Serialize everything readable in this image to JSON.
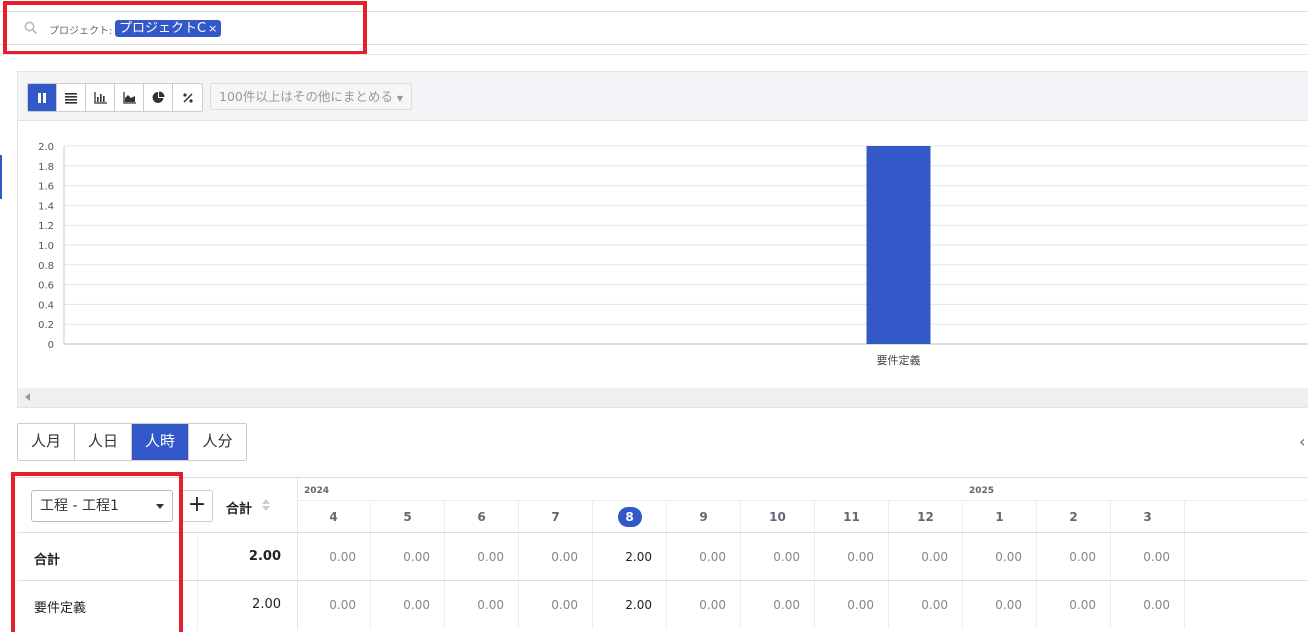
{
  "search": {
    "field_label": "プロジェクト:",
    "chip": "プロジェクトC",
    "chip_remove": "×"
  },
  "toolbar": {
    "icons": [
      "pause-icon",
      "list-icon",
      "bar-chart-icon",
      "area-chart-icon",
      "pie-chart-icon",
      "percent-icon"
    ],
    "group_select": "100件以上はその他にまとめる"
  },
  "chart_data": {
    "type": "bar",
    "categories": [
      "要件定義"
    ],
    "values": [
      2.0
    ],
    "ylim": [
      0,
      2.0
    ],
    "yticks": [
      "0",
      "0.2",
      "0.4",
      "0.6",
      "0.8",
      "1.0",
      "1.2",
      "1.4",
      "1.6",
      "1.8",
      "2.0"
    ],
    "grid": true,
    "colors": {
      "bar": "#3358c8"
    }
  },
  "units": [
    "人月",
    "人日",
    "人時",
    "人分"
  ],
  "active_unit": "人時",
  "table": {
    "dimension_select": "工程 - 工程1",
    "add_label": "+",
    "total_header": "合計",
    "years": [
      "2024",
      "2025"
    ],
    "months": [
      "4",
      "5",
      "6",
      "7",
      "8",
      "9",
      "10",
      "11",
      "12",
      "1",
      "2",
      "3"
    ],
    "current_month": "8",
    "rows": [
      {
        "label": "合計",
        "total": "2.00",
        "values": [
          "0.00",
          "0.00",
          "0.00",
          "0.00",
          "2.00",
          "0.00",
          "0.00",
          "0.00",
          "0.00",
          "0.00",
          "0.00",
          "0.00"
        ]
      },
      {
        "label": "要件定義",
        "total": "2.00",
        "values": [
          "0.00",
          "0.00",
          "0.00",
          "0.00",
          "2.00",
          "0.00",
          "0.00",
          "0.00",
          "0.00",
          "0.00",
          "0.00",
          "0.00"
        ]
      }
    ]
  },
  "colors": {
    "accent": "#3358c8",
    "highlight": "#e5202b"
  }
}
